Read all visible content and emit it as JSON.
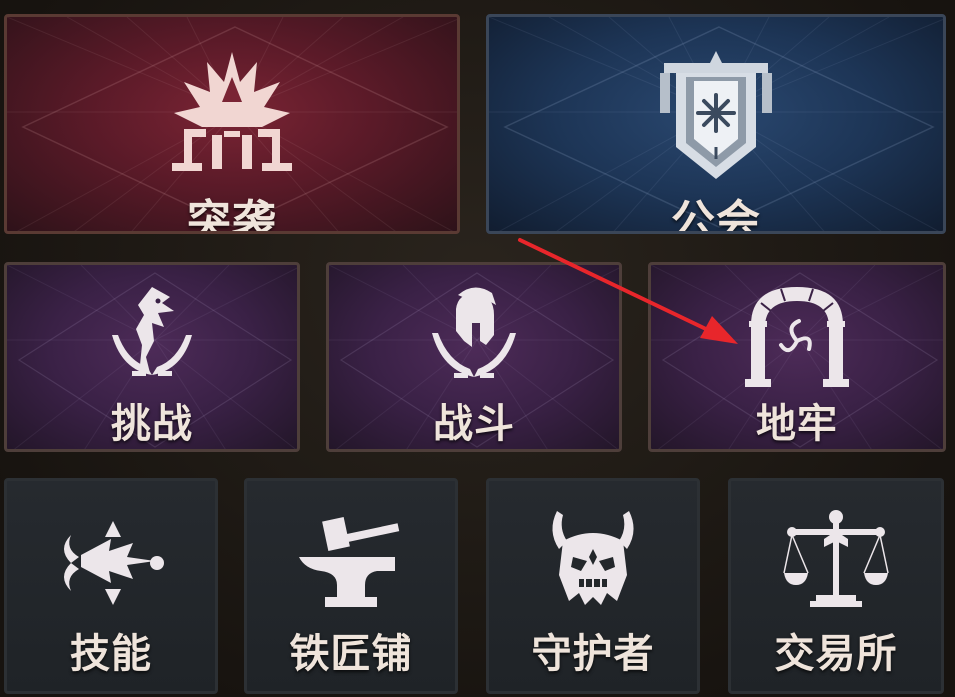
{
  "tiles": {
    "raid": {
      "label": "突袭",
      "icon": "raid-crown-icon"
    },
    "guild": {
      "label": "公会",
      "icon": "guild-banner-icon"
    },
    "challenge": {
      "label": "挑战",
      "icon": "dragon-swords-icon"
    },
    "battle": {
      "label": "战斗",
      "icon": "helmet-swords-icon"
    },
    "dungeon": {
      "label": "地牢",
      "icon": "portal-arch-icon"
    },
    "skill": {
      "label": "技能",
      "icon": "skill-blade-icon"
    },
    "smith": {
      "label": "铁匠铺",
      "icon": "anvil-hammer-icon"
    },
    "guardian": {
      "label": "守护者",
      "icon": "demon-skull-icon"
    },
    "market": {
      "label": "交易所",
      "icon": "scales-icon"
    }
  },
  "colors": {
    "raid_bg": "#5a1a28",
    "guild_bg": "#1d3556",
    "mid_bg": "#3a2146",
    "small_bg": "#23272b",
    "label": "#efe4db",
    "annotation_arrow": "#e8262b"
  }
}
